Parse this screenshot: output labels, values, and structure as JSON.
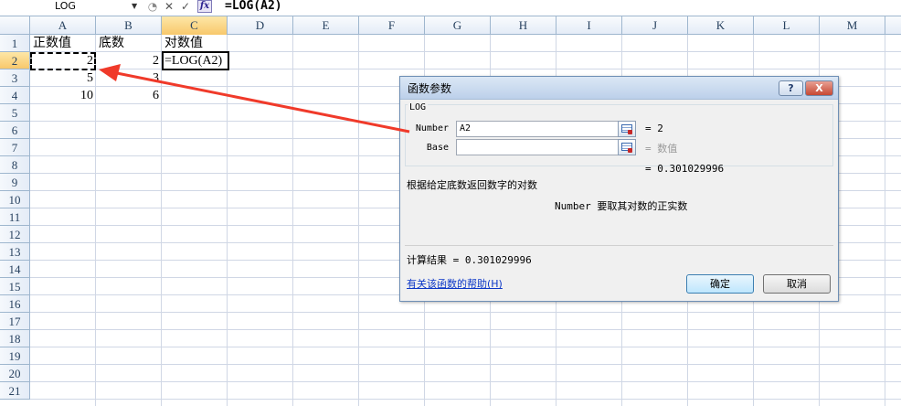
{
  "formula_bar": {
    "name_box": "LOG",
    "cancel_glyph": "✕",
    "enter_glyph": "✓",
    "fx_label": "fx",
    "formula": "=LOG(A2)"
  },
  "columns": [
    "A",
    "B",
    "C",
    "D",
    "E",
    "F",
    "G",
    "H",
    "I",
    "J",
    "K",
    "L",
    "M"
  ],
  "selected_column": "C",
  "rows": [
    "1",
    "2",
    "3",
    "4",
    "5",
    "6",
    "7",
    "8",
    "9",
    "10",
    "11",
    "12",
    "13",
    "14",
    "15",
    "16",
    "17",
    "18",
    "19",
    "20",
    "21"
  ],
  "selected_row": "2",
  "cells": {
    "a1": "正数值",
    "b1": "底数",
    "c1": "对数值",
    "a2": "2",
    "b2": "2",
    "c2": "=LOG(A2)",
    "a3": "5",
    "b3": "3",
    "a4": "10",
    "b4": "6"
  },
  "dialog": {
    "title": "函数参数",
    "help_glyph": "?",
    "close_glyph": "X",
    "function_name": "LOG",
    "args": [
      {
        "label": "Number",
        "value": "A2",
        "result": "= 2"
      },
      {
        "label": "Base",
        "value": "",
        "result": "= 数值"
      }
    ],
    "formula_result": "= 0.301029996",
    "description": "根据给定底数返回数字的对数",
    "arg_description": "Number  要取其对数的正实数",
    "calc_result": "计算结果 = 0.301029996",
    "help_link": "有关该函数的帮助(H)",
    "ok_label": "确定",
    "cancel_label": "取消"
  },
  "annotation": {
    "arrow_color": "#f03a2a"
  }
}
